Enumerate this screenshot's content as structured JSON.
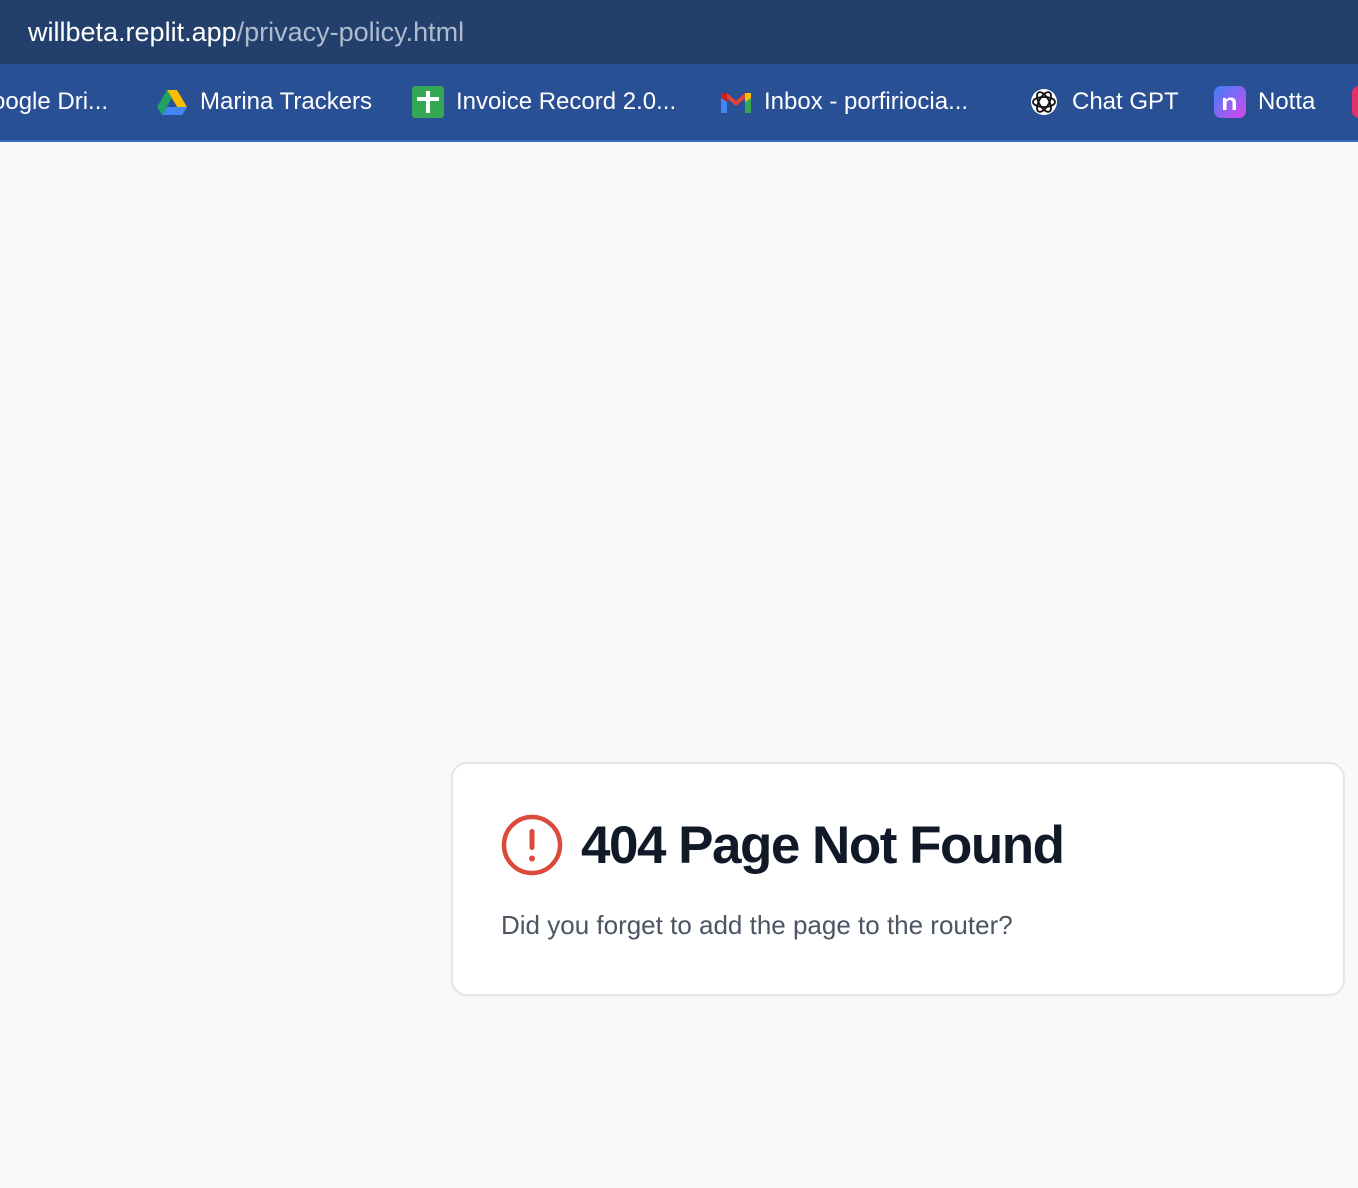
{
  "browser": {
    "url_host": "willbeta.replit.app",
    "url_path": "/privacy-policy.html"
  },
  "bookmarks": [
    {
      "label": "oogle Dri...",
      "icon": "google-drive-icon"
    },
    {
      "label": "Marina Trackers",
      "icon": "google-drive-icon"
    },
    {
      "label": "Invoice Record 2.0...",
      "icon": "google-sheets-icon"
    },
    {
      "label": "Inbox - porfiriocia...",
      "icon": "gmail-icon"
    },
    {
      "label": "Chat GPT",
      "icon": "openai-icon"
    },
    {
      "label": "Notta",
      "icon": "notta-icon"
    }
  ],
  "error_card": {
    "title": "404 Page Not Found",
    "description": "Did you forget to add the page to the router?",
    "icon": "alert-circle-icon"
  },
  "colors": {
    "url_bar_bg": "#233f6b",
    "bookmarks_bar_bg": "#294f94",
    "page_bg": "#f8f9fb",
    "alert_red": "#dc4a3d",
    "title_text": "#111827",
    "desc_text": "#4b5563"
  }
}
